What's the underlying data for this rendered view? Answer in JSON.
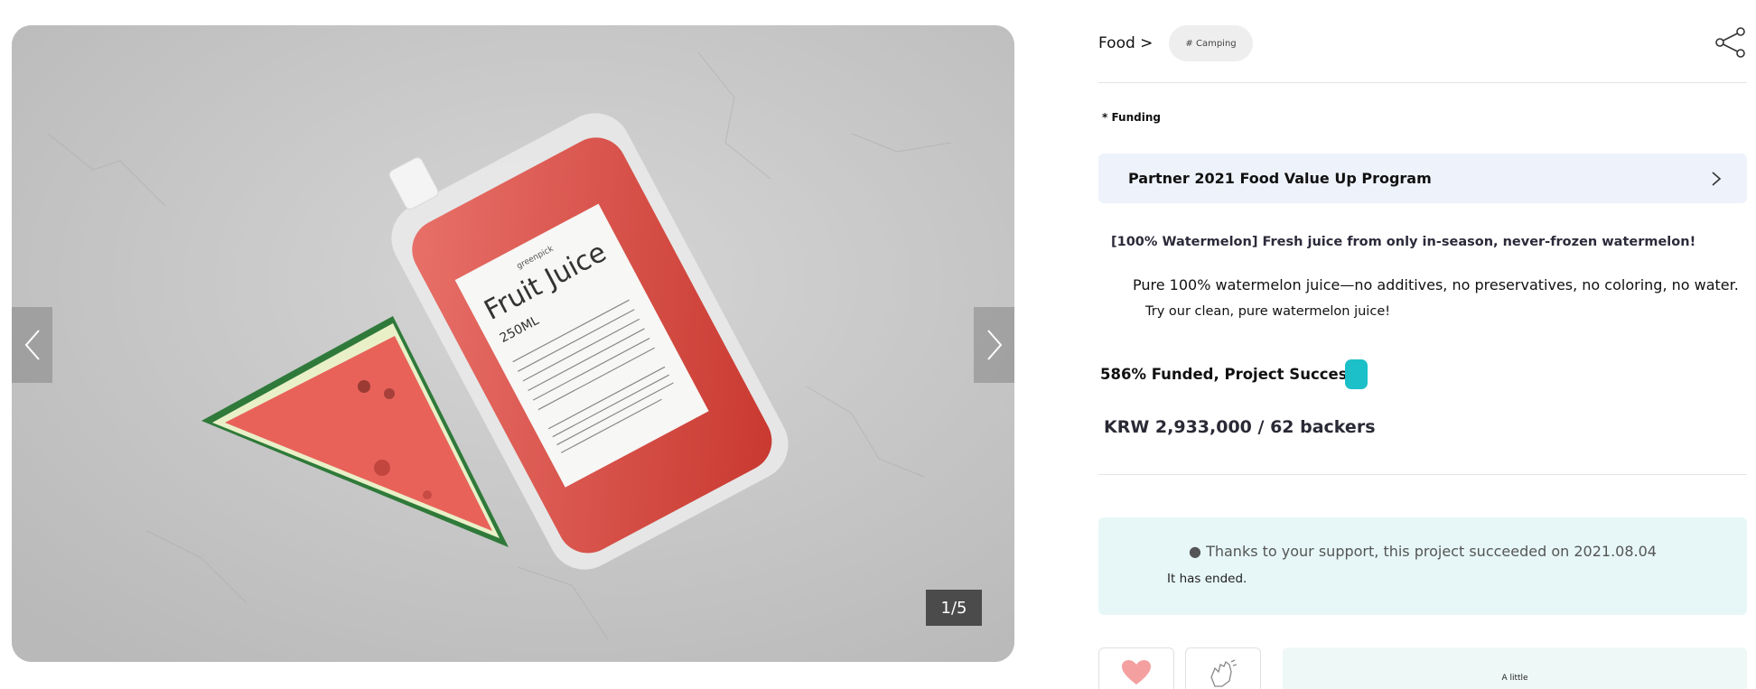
{
  "gallery": {
    "counter": "1/5",
    "product": {
      "brand": "greenpick",
      "name": "Fruit Juice",
      "volume": "250ML"
    },
    "colors": {
      "background": "#c8c8c8",
      "watermelon_flesh": "#e8625a",
      "watermelon_rind": "#2f7a3a",
      "juice": "#d94a3f"
    }
  },
  "breadcrumb": {
    "category": "Food >",
    "tag": "# Camping"
  },
  "share": {
    "icon": "share-icon"
  },
  "funding": {
    "label": "* Funding"
  },
  "program": {
    "title": "Partner 2021 Food Value Up Program",
    "icon": "chevron-right-icon"
  },
  "project": {
    "headline": "[100% Watermelon] Fresh juice from only in-season, never-frozen watermelon!",
    "description_line1": "Pure 100% watermelon juice—no additives, no preservatives, no coloring, no water.",
    "description_line2": "Try our clean, pure watermelon juice!",
    "success_text": "586% Funded, Project Success",
    "amount_text": "KRW 2,933,000 / 62 backers"
  },
  "notice": {
    "main": "● Thanks to your support, this project succeeded on 2021.08.04",
    "sub": "It has ended."
  },
  "actions": {
    "like_icon": "heart-icon",
    "cheer_icon": "clap-icon",
    "card_text": "A little"
  },
  "theme": {
    "accent_teal": "#1cc0c8",
    "program_bg": "#eef2fb",
    "notice_bg": "#e7f7f7",
    "heart": "#f4a0a0"
  }
}
